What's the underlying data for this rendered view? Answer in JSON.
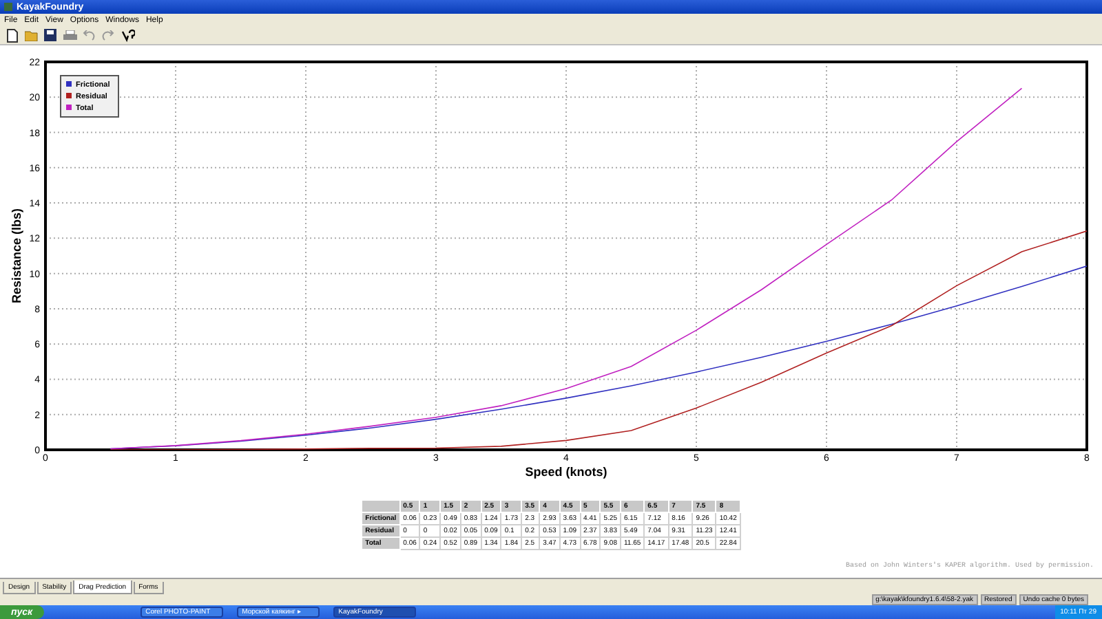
{
  "window": {
    "title": "KayakFoundry"
  },
  "menu": [
    "File",
    "Edit",
    "View",
    "Options",
    "Windows",
    "Help"
  ],
  "chart": {
    "chart_data": {
      "type": "line",
      "grid": true,
      "legend": true,
      "xlabel": "Speed (knots)",
      "ylabel": "Resistance (lbs)",
      "x": [
        0.5,
        1,
        1.5,
        2,
        2.5,
        3,
        3.5,
        4,
        4.5,
        5,
        5.5,
        6,
        6.5,
        7,
        7.5,
        8
      ],
      "xlim": [
        0,
        8
      ],
      "ylim": [
        0,
        22
      ],
      "xticks": [
        0,
        1,
        2,
        3,
        4,
        5,
        6,
        7,
        8
      ],
      "yticks": [
        0,
        2,
        4,
        6,
        8,
        10,
        12,
        14,
        16,
        18,
        20,
        22
      ],
      "series": [
        {
          "name": "Frictional",
          "color": "#3030c0",
          "values": [
            0.06,
            0.23,
            0.49,
            0.83,
            1.24,
            1.73,
            2.3,
            2.93,
            3.63,
            4.41,
            5.25,
            6.15,
            7.12,
            8.16,
            9.26,
            10.42
          ]
        },
        {
          "name": "Residual",
          "color": "#b02020",
          "values": [
            0,
            0,
            0.02,
            0.05,
            0.09,
            0.1,
            0.2,
            0.53,
            1.09,
            2.37,
            3.83,
            5.49,
            7.04,
            9.31,
            11.23,
            12.41
          ]
        },
        {
          "name": "Total",
          "color": "#c020c0",
          "values": [
            0.06,
            0.24,
            0.52,
            0.89,
            1.34,
            1.84,
            2.5,
            3.47,
            4.73,
            6.78,
            9.08,
            11.65,
            14.17,
            17.48,
            20.5,
            null
          ]
        }
      ]
    }
  },
  "table": {
    "columns": [
      "0.5",
      "1",
      "1.5",
      "2",
      "2.5",
      "3",
      "3.5",
      "4",
      "4.5",
      "5",
      "5.5",
      "6",
      "6.5",
      "7",
      "7.5",
      "8"
    ],
    "rows": [
      {
        "label": "Frictional",
        "cells": [
          "0.06",
          "0.23",
          "0.49",
          "0.83",
          "1.24",
          "1.73",
          "2.3",
          "2.93",
          "3.63",
          "4.41",
          "5.25",
          "6.15",
          "7.12",
          "8.16",
          "9.26",
          "10.42"
        ]
      },
      {
        "label": "Residual",
        "cells": [
          "0",
          "0",
          "0.02",
          "0.05",
          "0.09",
          "0.1",
          "0.2",
          "0.53",
          "1.09",
          "2.37",
          "3.83",
          "5.49",
          "7.04",
          "9.31",
          "11.23",
          "12.41"
        ]
      },
      {
        "label": "Total",
        "cells": [
          "0.06",
          "0.24",
          "0.52",
          "0.89",
          "1.34",
          "1.84",
          "2.5",
          "3.47",
          "4.73",
          "6.78",
          "9.08",
          "11.65",
          "14.17",
          "17.48",
          "20.5",
          "22.84"
        ]
      }
    ]
  },
  "attribution": "Based on John Winters's KAPER algorithm.  Used by permission.",
  "tabs": [
    {
      "label": "Design",
      "selected": false
    },
    {
      "label": "Stability",
      "selected": false
    },
    {
      "label": "Drag Prediction",
      "selected": true
    },
    {
      "label": "Forms",
      "selected": false
    }
  ],
  "status_bar": [
    "g:\\kayak\\kfoundry1.6.4\\58-2.yak",
    "Restored",
    "Undo cache 0 bytes"
  ],
  "taskbar": {
    "start": "пуск",
    "tasks": [
      {
        "label": "Corel PHOTO-PAINT",
        "selected": false
      },
      {
        "label": "Морской каякинг ▸",
        "selected": false
      },
      {
        "label": "KayakFoundry",
        "selected": true
      }
    ],
    "clock": "10:11 Пт 29"
  }
}
